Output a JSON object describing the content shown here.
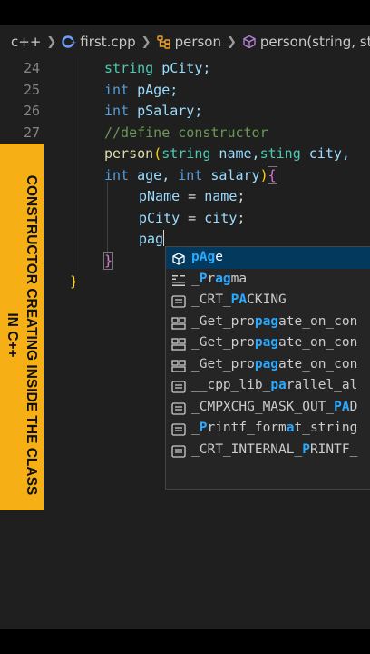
{
  "breadcrumb": {
    "lang": "c++",
    "file": "first.cpp",
    "class": "person",
    "method": "person(string, stri"
  },
  "line_numbers": [
    "24",
    "25",
    "26",
    "27"
  ],
  "code": {
    "l24_type": "string",
    "l24_name": " pCity;",
    "l25_type": "int",
    "l25_name": " pAge;",
    "l26_type": "int",
    "l26_name": " pSalary;",
    "l27_comment": "//define constructor",
    "l28_fn": "person",
    "l28_paren": "(",
    "l28_t1": "string",
    "l28_p1": " name,",
    "l28_t2": "sting",
    "l28_p2": " city,",
    "l29_t1": "int",
    "l29_p1": " age, ",
    "l29_t2": "int",
    "l29_p2": " salary",
    "l29_close": ")",
    "l29_brace": "{",
    "l30_lhs": "pName",
    "l30_op": " = ",
    "l30_rhs": "name",
    "l30_end": ";",
    "l31_lhs": "pCity",
    "l31_op": " = ",
    "l31_rhs": "city",
    "l31_end": ";",
    "l32_typed": "pag",
    "l33_brace": "}",
    "l34_brace": "}"
  },
  "banner": {
    "text": "CONSTRUCTOR CREATING INSIDE THE CLASS IN C++",
    "color": "#f6b016"
  },
  "suggestions": [
    {
      "icon": "field-icon",
      "pre": "",
      "match": "pAg",
      "post": "e",
      "selected": true
    },
    {
      "icon": "snippet-icon",
      "pre": "_",
      "match": "P",
      "post": "r",
      "match2": "ag",
      "post2": "ma"
    },
    {
      "icon": "text-icon",
      "pre": "_CRT_",
      "match": "PA",
      "post": "CKING"
    },
    {
      "icon": "struct-icon",
      "pre": "_Get_pro",
      "match": "pag",
      "post": "ate_on_con"
    },
    {
      "icon": "struct-icon",
      "pre": "_Get_pro",
      "match": "pag",
      "post": "ate_on_con"
    },
    {
      "icon": "struct-icon",
      "pre": "_Get_pro",
      "match": "pag",
      "post": "ate_on_con"
    },
    {
      "icon": "text-icon",
      "pre": "__cpp_lib_",
      "match": "pa",
      "post": "rallel_al"
    },
    {
      "icon": "text-icon",
      "pre": "_CMPXCHG_MASK_OUT_",
      "match": "PA",
      "post": "D"
    },
    {
      "icon": "text-icon",
      "pre": "_",
      "match": "P",
      "post": "rintf_form",
      "match2": "a",
      "post2": "t_string"
    },
    {
      "icon": "text-icon",
      "pre": "_CRT_INTERNAL_",
      "match": "P",
      "post": "RINTF_"
    }
  ]
}
